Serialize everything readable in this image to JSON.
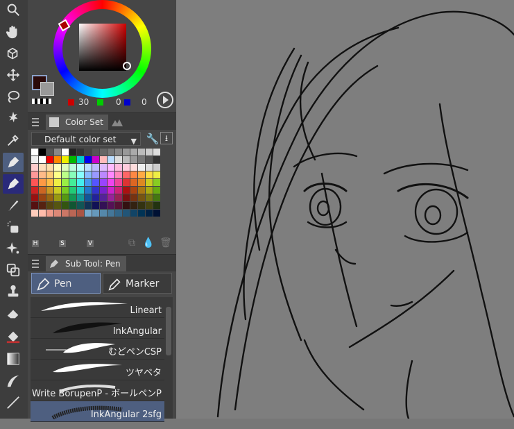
{
  "tools": [
    {
      "icon": "magnifier-icon"
    },
    {
      "icon": "hand-icon"
    },
    {
      "icon": "object-icon"
    },
    {
      "icon": "move-icon"
    },
    {
      "icon": "lasso-icon"
    },
    {
      "icon": "magic-wand-icon"
    },
    {
      "icon": "eyedropper-icon"
    },
    {
      "icon": "pen-icon"
    },
    {
      "icon": "pencil-icon"
    },
    {
      "icon": "brush-icon"
    },
    {
      "icon": "airbrush-icon"
    },
    {
      "icon": "decoration-icon"
    },
    {
      "icon": "blend-icon"
    },
    {
      "icon": "stamp-icon"
    },
    {
      "icon": "eraser-icon"
    },
    {
      "icon": "fill-icon"
    },
    {
      "icon": "gradient-icon"
    },
    {
      "icon": "figure-icon"
    },
    {
      "icon": "ruler-icon"
    }
  ],
  "color": {
    "main": "#2a0a0a",
    "rgb": {
      "r": "30",
      "g": "0",
      "b": "0"
    },
    "r_color": "#cc0000",
    "g_color": "#00cc00",
    "b_color": "#0000cc"
  },
  "color_set": {
    "tab_label": "Color Set",
    "set_name": "Default color set",
    "hsv_labels": [
      "H",
      "S",
      "V"
    ]
  },
  "sub_tool": {
    "tab_label": "Sub Tool: Pen",
    "groups": [
      {
        "label": "Pen"
      },
      {
        "label": "Marker"
      }
    ],
    "brushes": [
      {
        "label": "Lineart"
      },
      {
        "label": "InkAngular"
      },
      {
        "label": "むどペンCSP"
      },
      {
        "label": "ツヤベタ"
      },
      {
        "label": "Write BorupenP - ボールペンP"
      },
      {
        "label": "InkAngular 2sfg"
      }
    ]
  }
}
